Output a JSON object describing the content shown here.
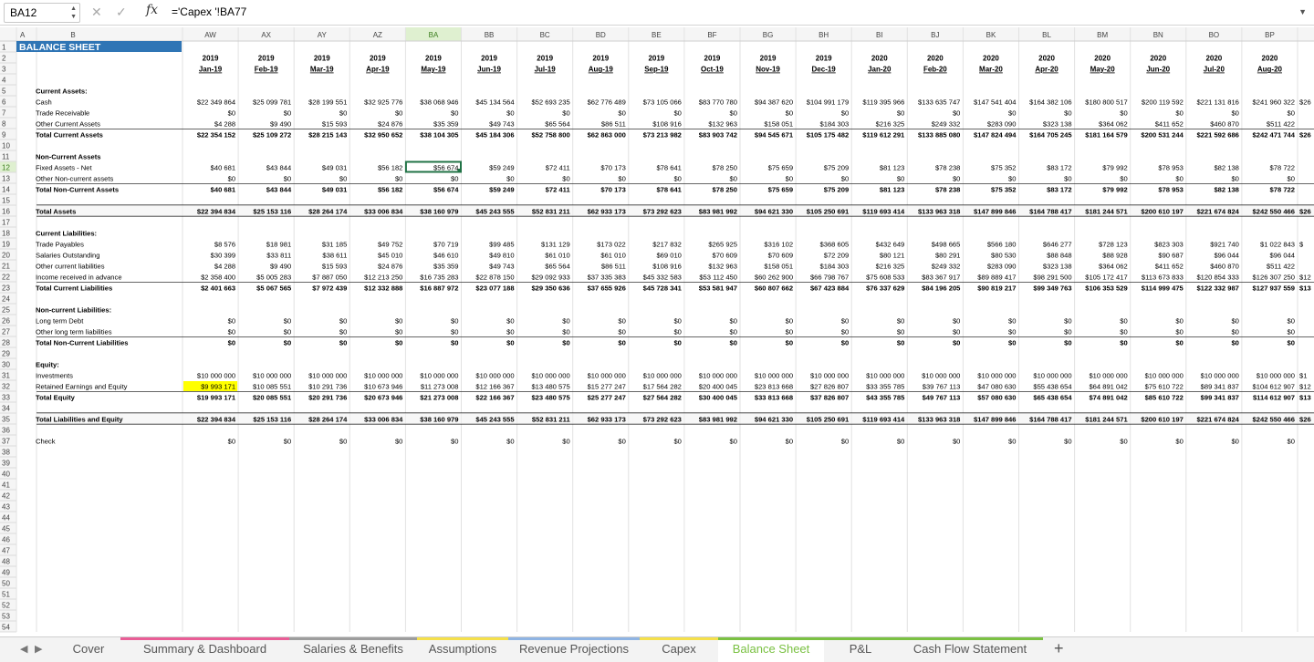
{
  "formula_bar": {
    "cell_ref": "BA12",
    "formula": "='Capex '!BA77",
    "fx_label": "fx",
    "cancel_icon": "close-icon",
    "confirm_icon": "check-icon"
  },
  "sheet": {
    "columns": [
      "AW",
      "AX",
      "AY",
      "AZ",
      "BA",
      "BB",
      "BC",
      "BD",
      "BE",
      "BF",
      "BG",
      "BH",
      "BI",
      "BJ",
      "BK",
      "BL",
      "BM",
      "BN",
      "BO",
      "BP"
    ],
    "selected_col": "BA",
    "selected_row": 12,
    "row_count": 54,
    "first_cols": [
      "A",
      "B"
    ],
    "title": "BALANCE SHEET",
    "years": [
      "2019",
      "2019",
      "2019",
      "2019",
      "2019",
      "2019",
      "2019",
      "2019",
      "2019",
      "2019",
      "2019",
      "2019",
      "2020",
      "2020",
      "2020",
      "2020",
      "2020",
      "2020",
      "2020",
      "2020"
    ],
    "months": [
      "Jan-19",
      "Feb-19",
      "Mar-19",
      "Apr-19",
      "May-19",
      "Jun-19",
      "Jul-19",
      "Aug-19",
      "Sep-19",
      "Oct-19",
      "Nov-19",
      "Dec-19",
      "Jan-20",
      "Feb-20",
      "Mar-20",
      "Apr-20",
      "May-20",
      "Jun-20",
      "Jul-20",
      "Aug-20"
    ],
    "rows": [
      {
        "r": 5,
        "label": "Current Assets:",
        "bold": true
      },
      {
        "r": 6,
        "label": "Cash",
        "values": [
          "$22 349 864",
          "$25 099 781",
          "$28 199 551",
          "$32 925 776",
          "$38 068 946",
          "$45 134 564",
          "$52 693 235",
          "$62 776 489",
          "$73 105 066",
          "$83 770 780",
          "$94 387 620",
          "$104 991 179",
          "$119 395 966",
          "$133 635 747",
          "$147 541 404",
          "$164 382 106",
          "$180 800 517",
          "$200 119 592",
          "$221 131 816",
          "$241 960 322"
        ]
      },
      {
        "r": 7,
        "label": "Trade Receivable",
        "values": [
          "$0",
          "$0",
          "$0",
          "$0",
          "$0",
          "$0",
          "$0",
          "$0",
          "$0",
          "$0",
          "$0",
          "$0",
          "$0",
          "$0",
          "$0",
          "$0",
          "$0",
          "$0",
          "$0",
          "$0"
        ]
      },
      {
        "r": 8,
        "label": "Other Current Assets",
        "values": [
          "$4 288",
          "$9 490",
          "$15 593",
          "$24 876",
          "$35 359",
          "$49 743",
          "$65 564",
          "$86 511",
          "$108 916",
          "$132 963",
          "$158 051",
          "$184 303",
          "$216 325",
          "$249 332",
          "$283 090",
          "$323 138",
          "$364 062",
          "$411 652",
          "$460 870",
          "$511 422"
        ]
      },
      {
        "r": 9,
        "label": "Total Current Assets",
        "bold": true,
        "border": "top",
        "values": [
          "$22 354 152",
          "$25 109 272",
          "$28 215 143",
          "$32 950 652",
          "$38 104 305",
          "$45 184 306",
          "$52 758 800",
          "$62 863 000",
          "$73 213 982",
          "$83 903 742",
          "$94 545 671",
          "$105 175 482",
          "$119 612 291",
          "$133 885 080",
          "$147 824 494",
          "$164 705 245",
          "$181 164 579",
          "$200 531 244",
          "$221 592 686",
          "$242 471 744"
        ]
      },
      {
        "r": 11,
        "label": "Non-Current Assets",
        "bold": true
      },
      {
        "r": 12,
        "label": "Fixed Assets - Net",
        "values": [
          "$40 681",
          "$43 844",
          "$49 031",
          "$56 182",
          "$56 674",
          "$59 249",
          "$72 411",
          "$70 173",
          "$78 641",
          "$78 250",
          "$75 659",
          "$75 209",
          "$81 123",
          "$78 238",
          "$75 352",
          "$83 172",
          "$79 992",
          "$78 953",
          "$82 138",
          "$78 722"
        ]
      },
      {
        "r": 13,
        "label": "Other Non-current assets",
        "values": [
          "$0",
          "$0",
          "$0",
          "$0",
          "$0",
          "$0",
          "$0",
          "$0",
          "$0",
          "$0",
          "$0",
          "$0",
          "$0",
          "$0",
          "$0",
          "$0",
          "$0",
          "$0",
          "$0",
          "$0"
        ]
      },
      {
        "r": 14,
        "label": "Total Non-Current Assets",
        "bold": true,
        "border": "top",
        "values": [
          "$40 681",
          "$43 844",
          "$49 031",
          "$56 182",
          "$56 674",
          "$59 249",
          "$72 411",
          "$70 173",
          "$78 641",
          "$78 250",
          "$75 659",
          "$75 209",
          "$81 123",
          "$78 238",
          "$75 352",
          "$83 172",
          "$79 992",
          "$78 953",
          "$82 138",
          "$78 722"
        ]
      },
      {
        "r": 16,
        "label": "Total Assets",
        "bold": true,
        "border": "band",
        "values": [
          "$22 394 834",
          "$25 153 116",
          "$28 264 174",
          "$33 006 834",
          "$38 160 979",
          "$45 243 555",
          "$52 831 211",
          "$62 933 173",
          "$73 292 623",
          "$83 981 992",
          "$94 621 330",
          "$105 250 691",
          "$119 693 414",
          "$133 963 318",
          "$147 899 846",
          "$164 788 417",
          "$181 244 571",
          "$200 610 197",
          "$221 674 824",
          "$242 550 466"
        ]
      },
      {
        "r": 18,
        "label": "Current Liabilities:",
        "bold": true
      },
      {
        "r": 19,
        "label": "Trade Payables",
        "values": [
          "$8 576",
          "$18 981",
          "$31 185",
          "$49 752",
          "$70 719",
          "$99 485",
          "$131 129",
          "$173 022",
          "$217 832",
          "$265 925",
          "$316 102",
          "$368 605",
          "$432 649",
          "$498 665",
          "$566 180",
          "$646 277",
          "$728 123",
          "$823 303",
          "$921 740",
          "$1 022 843"
        ]
      },
      {
        "r": 20,
        "label": "Salaries Outstanding",
        "values": [
          "$30 399",
          "$33 811",
          "$38 611",
          "$45 010",
          "$46 610",
          "$49 810",
          "$61 010",
          "$61 010",
          "$69 010",
          "$70 609",
          "$70 609",
          "$72 209",
          "$80 121",
          "$80 291",
          "$80 530",
          "$88 848",
          "$88 928",
          "$90 687",
          "$96 044",
          "$96 044"
        ]
      },
      {
        "r": 21,
        "label": "Other current liabilities",
        "values": [
          "$4 288",
          "$9 490",
          "$15 593",
          "$24 876",
          "$35 359",
          "$49 743",
          "$65 564",
          "$86 511",
          "$108 916",
          "$132 963",
          "$158 051",
          "$184 303",
          "$216 325",
          "$249 332",
          "$283 090",
          "$323 138",
          "$364 062",
          "$411 652",
          "$460 870",
          "$511 422"
        ]
      },
      {
        "r": 22,
        "label": "Income received in advance",
        "values": [
          "$2 358 400",
          "$5 005 283",
          "$7 887 050",
          "$12 213 250",
          "$16 735 283",
          "$22 878 150",
          "$29 092 933",
          "$37 335 383",
          "$45 332 583",
          "$53 112 450",
          "$60 262 900",
          "$66 798 767",
          "$75 608 533",
          "$83 367 917",
          "$89 889 417",
          "$98 291 500",
          "$105 172 417",
          "$113 673 833",
          "$120 854 333",
          "$126 307 250"
        ]
      },
      {
        "r": 23,
        "label": "Total Current Liabilities",
        "bold": true,
        "border": "top",
        "values": [
          "$2 401 663",
          "$5 067 565",
          "$7 972 439",
          "$12 332 888",
          "$16 887 972",
          "$23 077 188",
          "$29 350 636",
          "$37 655 926",
          "$45 728 341",
          "$53 581 947",
          "$60 807 662",
          "$67 423 884",
          "$76 337 629",
          "$84 196 205",
          "$90 819 217",
          "$99 349 763",
          "$106 353 529",
          "$114 999 475",
          "$122 332 987",
          "$127 937 559"
        ]
      },
      {
        "r": 25,
        "label": "Non-current Liabilities:",
        "bold": true
      },
      {
        "r": 26,
        "label": "Long term Debt",
        "values": [
          "$0",
          "$0",
          "$0",
          "$0",
          "$0",
          "$0",
          "$0",
          "$0",
          "$0",
          "$0",
          "$0",
          "$0",
          "$0",
          "$0",
          "$0",
          "$0",
          "$0",
          "$0",
          "$0",
          "$0"
        ]
      },
      {
        "r": 27,
        "label": "Other long term liabilities",
        "values": [
          "$0",
          "$0",
          "$0",
          "$0",
          "$0",
          "$0",
          "$0",
          "$0",
          "$0",
          "$0",
          "$0",
          "$0",
          "$0",
          "$0",
          "$0",
          "$0",
          "$0",
          "$0",
          "$0",
          "$0"
        ]
      },
      {
        "r": 28,
        "label": "Total Non-Current Liabilities",
        "bold": true,
        "border": "top",
        "values": [
          "$0",
          "$0",
          "$0",
          "$0",
          "$0",
          "$0",
          "$0",
          "$0",
          "$0",
          "$0",
          "$0",
          "$0",
          "$0",
          "$0",
          "$0",
          "$0",
          "$0",
          "$0",
          "$0",
          "$0"
        ]
      },
      {
        "r": 30,
        "label": "Equity:",
        "bold": true
      },
      {
        "r": 31,
        "label": "Investments",
        "values": [
          "$10 000 000",
          "$10 000 000",
          "$10 000 000",
          "$10 000 000",
          "$10 000 000",
          "$10 000 000",
          "$10 000 000",
          "$10 000 000",
          "$10 000 000",
          "$10 000 000",
          "$10 000 000",
          "$10 000 000",
          "$10 000 000",
          "$10 000 000",
          "$10 000 000",
          "$10 000 000",
          "$10 000 000",
          "$10 000 000",
          "$10 000 000",
          "$10 000 000"
        ]
      },
      {
        "r": 32,
        "label": "Retained Earnings and Equity",
        "values": [
          "$9 993 171",
          "$10 085 551",
          "$10 291 736",
          "$10 673 946",
          "$11 273 008",
          "$12 166 367",
          "$13 480 575",
          "$15 277 247",
          "$17 564 282",
          "$20 400 045",
          "$23 813 668",
          "$27 826 807",
          "$33 355 785",
          "$39 767 113",
          "$47 080 630",
          "$55 438 654",
          "$64 891 042",
          "$75 610 722",
          "$89 341 837",
          "$104 612 907"
        ]
      },
      {
        "r": 33,
        "label": "Total Equity",
        "bold": true,
        "border": "top",
        "values": [
          "$19 993 171",
          "$20 085 551",
          "$20 291 736",
          "$20 673 946",
          "$21 273 008",
          "$22 166 367",
          "$23 480 575",
          "$25 277 247",
          "$27 564 282",
          "$30 400 045",
          "$33 813 668",
          "$37 826 807",
          "$43 355 785",
          "$49 767 113",
          "$57 080 630",
          "$65 438 654",
          "$74 891 042",
          "$85 610 722",
          "$99 341 837",
          "$114 612 907"
        ]
      },
      {
        "r": 35,
        "label": "Total Liabilities and Equity",
        "bold": true,
        "border": "band",
        "values": [
          "$22 394 834",
          "$25 153 116",
          "$28 264 174",
          "$33 006 834",
          "$38 160 979",
          "$45 243 555",
          "$52 831 211",
          "$62 933 173",
          "$73 292 623",
          "$83 981 992",
          "$94 621 330",
          "$105 250 691",
          "$119 693 414",
          "$133 963 318",
          "$147 899 846",
          "$164 788 417",
          "$181 244 571",
          "$200 610 197",
          "$221 674 824",
          "$242 550 466"
        ]
      },
      {
        "r": 37,
        "label": "Check",
        "values": [
          "$0",
          "$0",
          "$0",
          "$0",
          "$0",
          "$0",
          "$0",
          "$0",
          "$0",
          "$0",
          "$0",
          "$0",
          "$0",
          "$0",
          "$0",
          "$0",
          "$0",
          "$0",
          "$0",
          "$0"
        ]
      }
    ],
    "partial_right": {
      "6": "$26",
      "9": "$26",
      "16": "$26",
      "19": "$",
      "22": "$12",
      "23": "$13",
      "31": "$1",
      "32": "$12",
      "33": "$13",
      "35": "$26"
    },
    "highlight_cell": {
      "row": 32,
      "col": 0,
      "color": "#ffff00"
    },
    "title_color": "#2f75b5",
    "selected_header_color": "#dff0d0"
  },
  "tabs": {
    "active": "Balance Sheet",
    "items": [
      {
        "label": "Cover",
        "color": ""
      },
      {
        "label": "Summary & Dashboard",
        "color": "#e95d96"
      },
      {
        "label": "Salaries & Benefits",
        "color": "#9d9d9d"
      },
      {
        "label": "Assumptions",
        "color": "#f5e04a"
      },
      {
        "label": "Revenue Projections",
        "color": "#8fb4e3"
      },
      {
        "label": "Capex",
        "color": "#f5e04a"
      },
      {
        "label": "Balance Sheet",
        "color": "#7ac142"
      },
      {
        "label": "P&L",
        "color": "#7ac142"
      },
      {
        "label": "Cash Flow Statement",
        "color": "#7ac142"
      }
    ],
    "add_label": "+",
    "prev_icon": "triangle-left-icon",
    "next_icon": "triangle-right-icon"
  }
}
